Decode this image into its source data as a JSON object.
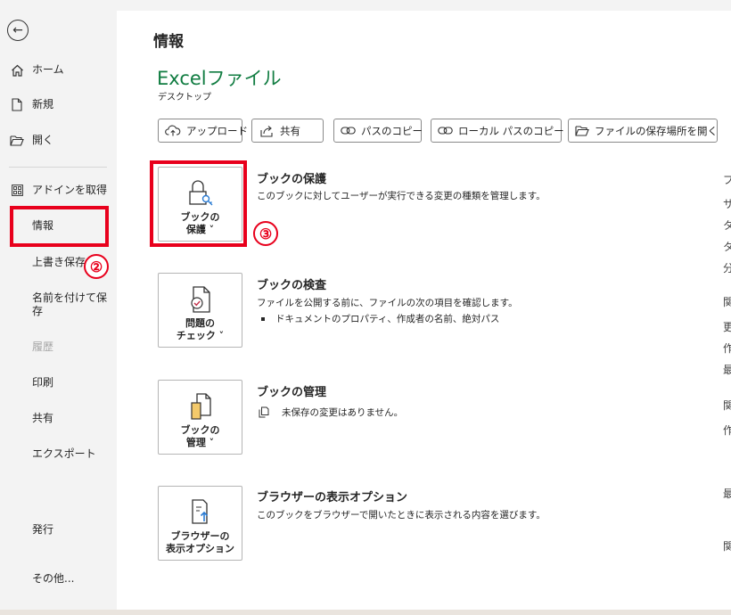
{
  "sidebar": {
    "back_icon": "arrow-left-circle-icon",
    "items": [
      {
        "label": "ホーム",
        "icon": "home-icon"
      },
      {
        "label": "新規",
        "icon": "new-document-icon"
      },
      {
        "label": "開く",
        "icon": "open-folder-icon"
      },
      {
        "label": "アドインを取得",
        "icon": "grid-icon"
      },
      {
        "label": "情報"
      },
      {
        "label": "上書き保存"
      },
      {
        "label": "名前を付けて保存"
      },
      {
        "label": "履歴",
        "disabled": true
      },
      {
        "label": "印刷"
      },
      {
        "label": "共有"
      },
      {
        "label": "エクスポート"
      },
      {
        "label": "発行"
      },
      {
        "label": "その他..."
      }
    ],
    "step_badge": "②"
  },
  "main": {
    "page_title": "情報",
    "file_title": "Excelファイル",
    "file_location": "デスクトップ",
    "toolbar": [
      {
        "label": "アップロード",
        "icon": "cloud-upload-icon"
      },
      {
        "label": "共有",
        "icon": "share-icon"
      },
      {
        "label": "パスのコピー",
        "icon": "link-icon"
      },
      {
        "label": "ローカル パスのコピー",
        "icon": "link-icon"
      },
      {
        "label": "ファイルの保存場所を開く",
        "icon": "folder-icon"
      }
    ],
    "sections": {
      "protect": {
        "tile_line1": "ブックの",
        "tile_line2": "保護 ˅",
        "title": "ブックの保護",
        "desc": "このブックに対してユーザーが実行できる変更の種類を管理します。",
        "step_badge": "③",
        "icon": "lock-key-icon"
      },
      "inspect": {
        "tile_line1": "問題の",
        "tile_line2": "チェック ˅",
        "title": "ブックの検査",
        "desc": "ファイルを公開する前に、ファイルの次の項目を確認します。",
        "bullet": "ドキュメントのプロパティ、作成者の名前、絶対パス",
        "icon": "document-check-icon"
      },
      "manage": {
        "tile_line1": "ブックの",
        "tile_line2": "管理 ˅",
        "title": "ブックの管理",
        "desc": "未保存の変更はありません。",
        "icon": "document-manage-icon"
      },
      "browser": {
        "tile_line1": "ブラウザーの",
        "tile_line2": "表示オプション",
        "title": "ブラウザーの表示オプション",
        "desc": "このブックをブラウザーで開いたときに表示される内容を選びます。",
        "icon": "browser-view-icon"
      }
    },
    "right_edge_glyphs": [
      "プ",
      "サ",
      "タ",
      "タ",
      "分",
      "関",
      "更",
      "作",
      "最",
      "関",
      "作",
      "最",
      "関"
    ]
  },
  "colors": {
    "accent_green": "#107c41",
    "highlight_red": "#e8001c"
  }
}
